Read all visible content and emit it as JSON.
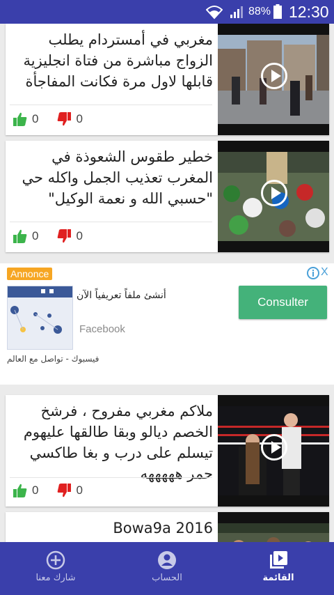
{
  "status_bar": {
    "battery": "88%",
    "time": "12:30"
  },
  "feed": {
    "videos": [
      {
        "title": "مغربي في أمستردام يطلب الزواج مباشرة من فتاة انجليزية قابلها لاول مرة فكانت المفاجأة",
        "likes": "0",
        "dislikes": "0"
      },
      {
        "title": "خطير طقوس الشعوذة في المغرب تعذيب الجمل واكله حي \"حسبي الله و نعمة الوكيل\"",
        "likes": "0",
        "dislikes": "0"
      },
      {
        "title": "ملاكم مغربي مفروح ، فرشخ الخصم ديالو وبقا طالقها عليهوم تيسلم على درب و بغا طاكسي حمر هههههه",
        "likes": "0",
        "dislikes": "0"
      },
      {
        "title": "Bowa9a 2016"
      }
    ]
  },
  "ad": {
    "label": "Annonce",
    "close": "X",
    "headline": "أنشئ ملفاً تعريفياً الآن",
    "brand": "Facebook",
    "caption": "فيسبوك - تواصل مع العالم",
    "cta": "Consulter"
  },
  "bottom_nav": {
    "items": [
      {
        "label": "شارك معنا",
        "icon": "add-circle-icon"
      },
      {
        "label": "الحساب",
        "icon": "account-icon"
      },
      {
        "label": "القائمة",
        "icon": "video-library-icon",
        "active": true
      }
    ]
  },
  "colors": {
    "primary": "#3a3fab",
    "like": "#3cb44b",
    "dislike": "#e02020",
    "ad_cta": "#44b27a",
    "ad_label": "#f6a623"
  }
}
